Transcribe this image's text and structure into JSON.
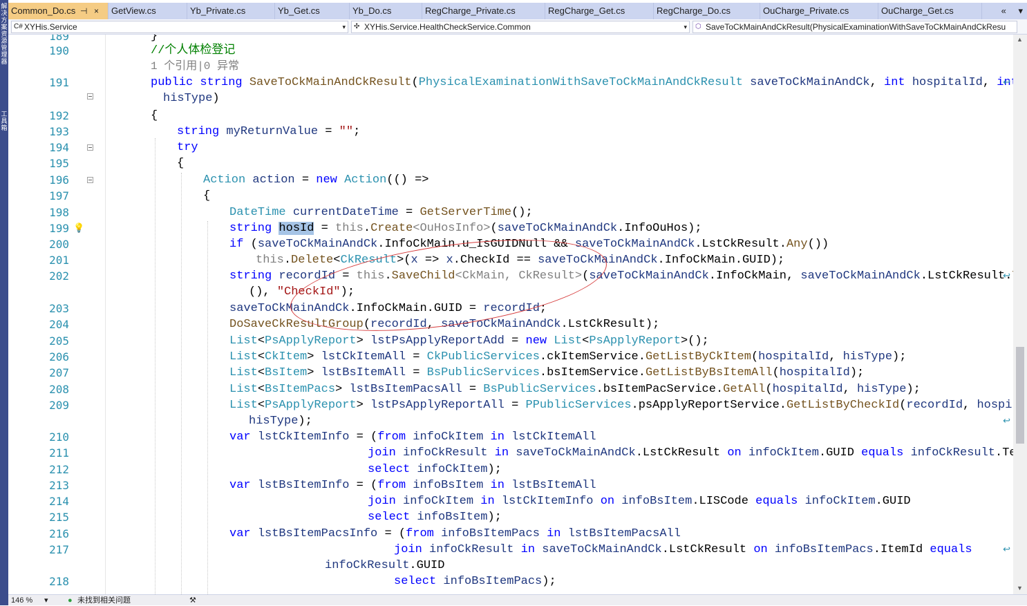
{
  "tabs": [
    {
      "label": "Common_Do.cs",
      "active": true
    },
    {
      "label": "GetView.cs"
    },
    {
      "label": "Yb_Private.cs"
    },
    {
      "label": "Yb_Get.cs"
    },
    {
      "label": "Yb_Do.cs"
    },
    {
      "label": "RegCharge_Private.cs"
    },
    {
      "label": "RegCharge_Get.cs"
    },
    {
      "label": "RegCharge_Do.cs"
    },
    {
      "label": "OuCharge_Private.cs"
    },
    {
      "label": "OuCharge_Get.cs"
    }
  ],
  "tab_pin": "⊣",
  "tab_close": "×",
  "tab_overflow": "«",
  "tab_dropdown": "▾",
  "side_labels": [
    "解决方案资源管理器",
    "工具箱"
  ],
  "nav": {
    "project_icon": "C#",
    "project": "XYHis.Service",
    "class": "XYHis.Service.HealthCheckService.Common",
    "member": "SaveToCkMainAndCkResult(PhysicalExaminationWithSaveToCkMainAndCkResu"
  },
  "status": {
    "zoom": "146 %",
    "issues": "未找到相关问题"
  },
  "codelens": "1 个引用|0 异常",
  "code_lines": [
    {
      "n": "189",
      "segs": [
        [
          "p",
          "}"
        ]
      ]
    },
    {
      "n": "190",
      "segs": [
        [
          "cm",
          "//个人体检登记"
        ]
      ]
    },
    {
      "n": "191",
      "segs": [
        [
          "k",
          "public"
        ],
        [
          "p",
          " "
        ],
        [
          "k",
          "string"
        ],
        [
          "p",
          " "
        ],
        [
          "m",
          "SaveToCkMainAndCkResult"
        ],
        [
          "p",
          "("
        ],
        [
          "t",
          "PhysicalExaminationWithSaveToCkMainAndCkResult"
        ],
        [
          "p",
          " "
        ],
        [
          "x",
          "saveToCkMainAndCk"
        ],
        [
          "p",
          ", "
        ],
        [
          "k",
          "int"
        ],
        [
          "p",
          " "
        ],
        [
          "x",
          "hospitalId"
        ],
        [
          "p",
          ", "
        ],
        [
          "k",
          "int"
        ]
      ]
    },
    {
      "n": "",
      "segs": [
        [
          "x",
          "hisType"
        ],
        [
          "p",
          ")"
        ]
      ]
    },
    {
      "n": "192",
      "segs": [
        [
          "p",
          "{"
        ]
      ]
    },
    {
      "n": "193",
      "segs": [
        [
          "k",
          "string"
        ],
        [
          "p",
          " "
        ],
        [
          "x",
          "myReturnValue"
        ],
        [
          "p",
          " = "
        ],
        [
          "s",
          "\"\""
        ],
        [
          "p",
          ";"
        ]
      ]
    },
    {
      "n": "194",
      "segs": [
        [
          "k",
          "try"
        ]
      ]
    },
    {
      "n": "195",
      "segs": [
        [
          "p",
          "{"
        ]
      ]
    },
    {
      "n": "196",
      "segs": [
        [
          "t",
          "Action"
        ],
        [
          "p",
          " "
        ],
        [
          "x",
          "action"
        ],
        [
          "p",
          " = "
        ],
        [
          "k",
          "new"
        ],
        [
          "p",
          " "
        ],
        [
          "t",
          "Action"
        ],
        [
          "p",
          "(() =>"
        ]
      ]
    },
    {
      "n": "197",
      "segs": [
        [
          "p",
          "{"
        ]
      ]
    },
    {
      "n": "198",
      "segs": [
        [
          "t",
          "DateTime"
        ],
        [
          "p",
          " "
        ],
        [
          "x",
          "currentDateTime"
        ],
        [
          "p",
          " = "
        ],
        [
          "m",
          "GetServerTime"
        ],
        [
          "p",
          "();"
        ]
      ]
    },
    {
      "n": "199",
      "segs": [
        [
          "k",
          "string"
        ],
        [
          "p",
          " "
        ],
        [
          "hl",
          "hosId"
        ],
        [
          "p",
          " = "
        ],
        [
          "g",
          "this"
        ],
        [
          "p",
          "."
        ],
        [
          "m",
          "Create"
        ],
        [
          "g",
          "<OuHosInfo>"
        ],
        [
          "p",
          "("
        ],
        [
          "x",
          "saveToCkMainAndCk"
        ],
        [
          "p",
          ".InfoOuHos);"
        ]
      ]
    },
    {
      "n": "200",
      "segs": [
        [
          "k",
          "if"
        ],
        [
          "p",
          " ("
        ],
        [
          "x",
          "saveToCkMainAndCk"
        ],
        [
          "p",
          ".InfoCkMain.u_IsGUIDNull && "
        ],
        [
          "x",
          "saveToCkMainAndCk"
        ],
        [
          "p",
          ".LstCkResult."
        ],
        [
          "m",
          "Any"
        ],
        [
          "p",
          "())"
        ]
      ]
    },
    {
      "n": "201",
      "segs": [
        [
          "g",
          "this"
        ],
        [
          "p",
          "."
        ],
        [
          "m",
          "Delete"
        ],
        [
          "p",
          "<"
        ],
        [
          "t",
          "CkResult"
        ],
        [
          "p",
          ">("
        ],
        [
          "x",
          "x"
        ],
        [
          "p",
          " => "
        ],
        [
          "x",
          "x"
        ],
        [
          "p",
          ".CheckId == "
        ],
        [
          "x",
          "saveToCkMainAndCk"
        ],
        [
          "p",
          ".InfoCkMain.GUID);"
        ]
      ]
    },
    {
      "n": "202",
      "segs": [
        [
          "k",
          "string"
        ],
        [
          "p",
          " "
        ],
        [
          "x",
          "recordId"
        ],
        [
          "p",
          " = "
        ],
        [
          "g",
          "this"
        ],
        [
          "p",
          "."
        ],
        [
          "m",
          "SaveChild"
        ],
        [
          "g",
          "<CkMain, CkResult>"
        ],
        [
          "p",
          "("
        ],
        [
          "x",
          "saveToCkMainAndCk"
        ],
        [
          "p",
          ".InfoCkMain, "
        ],
        [
          "x",
          "saveToCkMainAndCk"
        ],
        [
          "p",
          ".LstCkResult."
        ],
        [
          "m",
          "ToList"
        ]
      ]
    },
    {
      "n": "",
      "segs": [
        [
          "p",
          "(), "
        ],
        [
          "s",
          "\"CheckId\""
        ],
        [
          "p",
          ");"
        ]
      ]
    },
    {
      "n": "203",
      "segs": [
        [
          "x",
          "saveToCkMainAndCk"
        ],
        [
          "p",
          ".InfoCkMain.GUID = "
        ],
        [
          "x",
          "recordId"
        ],
        [
          "p",
          ";"
        ]
      ]
    },
    {
      "n": "204",
      "segs": [
        [
          "m",
          "DoSaveCkResultGroup"
        ],
        [
          "p",
          "("
        ],
        [
          "x",
          "recordId"
        ],
        [
          "p",
          ", "
        ],
        [
          "x",
          "saveToCkMainAndCk"
        ],
        [
          "p",
          ".LstCkResult);"
        ]
      ]
    },
    {
      "n": "205",
      "segs": [
        [
          "t",
          "List"
        ],
        [
          "p",
          "<"
        ],
        [
          "t",
          "PsApplyReport"
        ],
        [
          "p",
          "> "
        ],
        [
          "x",
          "lstPsApplyReportAdd"
        ],
        [
          "p",
          " = "
        ],
        [
          "k",
          "new"
        ],
        [
          "p",
          " "
        ],
        [
          "t",
          "List"
        ],
        [
          "p",
          "<"
        ],
        [
          "t",
          "PsApplyReport"
        ],
        [
          "p",
          ">();"
        ]
      ]
    },
    {
      "n": "206",
      "segs": [
        [
          "t",
          "List"
        ],
        [
          "p",
          "<"
        ],
        [
          "t",
          "CkItem"
        ],
        [
          "p",
          "> "
        ],
        [
          "x",
          "lstCkItemAll"
        ],
        [
          "p",
          " = "
        ],
        [
          "t",
          "CkPublicServices"
        ],
        [
          "p",
          ".ckItemService."
        ],
        [
          "m",
          "GetListByCkItem"
        ],
        [
          "p",
          "("
        ],
        [
          "x",
          "hospitalId"
        ],
        [
          "p",
          ", "
        ],
        [
          "x",
          "hisType"
        ],
        [
          "p",
          ");"
        ]
      ]
    },
    {
      "n": "207",
      "segs": [
        [
          "t",
          "List"
        ],
        [
          "p",
          "<"
        ],
        [
          "t",
          "BsItem"
        ],
        [
          "p",
          "> "
        ],
        [
          "x",
          "lstBsItemAll"
        ],
        [
          "p",
          " = "
        ],
        [
          "t",
          "BsPublicServices"
        ],
        [
          "p",
          ".bsItemService."
        ],
        [
          "m",
          "GetListByBsItemAll"
        ],
        [
          "p",
          "("
        ],
        [
          "x",
          "hospitalId"
        ],
        [
          "p",
          ");"
        ]
      ]
    },
    {
      "n": "208",
      "segs": [
        [
          "t",
          "List"
        ],
        [
          "p",
          "<"
        ],
        [
          "t",
          "BsItemPacs"
        ],
        [
          "p",
          "> "
        ],
        [
          "x",
          "lstBsItemPacsAll"
        ],
        [
          "p",
          " = "
        ],
        [
          "t",
          "BsPublicServices"
        ],
        [
          "p",
          ".bsItemPacService."
        ],
        [
          "m",
          "GetAll"
        ],
        [
          "p",
          "("
        ],
        [
          "x",
          "hospitalId"
        ],
        [
          "p",
          ", "
        ],
        [
          "x",
          "hisType"
        ],
        [
          "p",
          ");"
        ]
      ]
    },
    {
      "n": "209",
      "segs": [
        [
          "t",
          "List"
        ],
        [
          "p",
          "<"
        ],
        [
          "t",
          "PsApplyReport"
        ],
        [
          "p",
          "> "
        ],
        [
          "x",
          "lstPsApplyReportAll"
        ],
        [
          "p",
          " = "
        ],
        [
          "t",
          "PPublicServices"
        ],
        [
          "p",
          ".psApplyReportService."
        ],
        [
          "m",
          "GetListByCheckId"
        ],
        [
          "p",
          "("
        ],
        [
          "x",
          "recordId"
        ],
        [
          "p",
          ", "
        ],
        [
          "x",
          "hospitalId"
        ],
        [
          "p",
          ","
        ]
      ]
    },
    {
      "n": "",
      "segs": [
        [
          "x",
          "hisType"
        ],
        [
          "p",
          ");"
        ]
      ]
    },
    {
      "n": "210",
      "segs": [
        [
          "k",
          "var"
        ],
        [
          "p",
          " "
        ],
        [
          "x",
          "lstCkItemInfo"
        ],
        [
          "p",
          " = ("
        ],
        [
          "k",
          "from"
        ],
        [
          "p",
          " "
        ],
        [
          "x",
          "infoCkItem"
        ],
        [
          "p",
          " "
        ],
        [
          "k",
          "in"
        ],
        [
          "p",
          " "
        ],
        [
          "x",
          "lstCkItemAll"
        ]
      ]
    },
    {
      "n": "211",
      "segs": [
        [
          "k",
          "join"
        ],
        [
          "p",
          " "
        ],
        [
          "x",
          "infoCkResult"
        ],
        [
          "p",
          " "
        ],
        [
          "k",
          "in"
        ],
        [
          "p",
          " "
        ],
        [
          "x",
          "saveToCkMainAndCk"
        ],
        [
          "p",
          ".LstCkResult "
        ],
        [
          "k",
          "on"
        ],
        [
          "p",
          " "
        ],
        [
          "x",
          "infoCkItem"
        ],
        [
          "p",
          ".GUID "
        ],
        [
          "k",
          "equals"
        ],
        [
          "p",
          " "
        ],
        [
          "x",
          "infoCkResult"
        ],
        [
          "p",
          ".TestId"
        ]
      ]
    },
    {
      "n": "212",
      "segs": [
        [
          "k",
          "select"
        ],
        [
          "p",
          " "
        ],
        [
          "x",
          "infoCkItem"
        ],
        [
          "p",
          ");"
        ]
      ]
    },
    {
      "n": "213",
      "segs": [
        [
          "k",
          "var"
        ],
        [
          "p",
          " "
        ],
        [
          "x",
          "lstBsItemInfo"
        ],
        [
          "p",
          " = ("
        ],
        [
          "k",
          "from"
        ],
        [
          "p",
          " "
        ],
        [
          "x",
          "infoBsItem"
        ],
        [
          "p",
          " "
        ],
        [
          "k",
          "in"
        ],
        [
          "p",
          " "
        ],
        [
          "x",
          "lstBsItemAll"
        ]
      ]
    },
    {
      "n": "214",
      "segs": [
        [
          "k",
          "join"
        ],
        [
          "p",
          " "
        ],
        [
          "x",
          "infoCkItem"
        ],
        [
          "p",
          " "
        ],
        [
          "k",
          "in"
        ],
        [
          "p",
          " "
        ],
        [
          "x",
          "lstCkItemInfo"
        ],
        [
          "p",
          " "
        ],
        [
          "k",
          "on"
        ],
        [
          "p",
          " "
        ],
        [
          "x",
          "infoBsItem"
        ],
        [
          "p",
          ".LISCode "
        ],
        [
          "k",
          "equals"
        ],
        [
          "p",
          " "
        ],
        [
          "x",
          "infoCkItem"
        ],
        [
          "p",
          ".GUID"
        ]
      ]
    },
    {
      "n": "215",
      "segs": [
        [
          "k",
          "select"
        ],
        [
          "p",
          " "
        ],
        [
          "x",
          "infoBsItem"
        ],
        [
          "p",
          ");"
        ]
      ]
    },
    {
      "n": "216",
      "segs": [
        [
          "k",
          "var"
        ],
        [
          "p",
          " "
        ],
        [
          "x",
          "lstBsItemPacsInfo"
        ],
        [
          "p",
          " = ("
        ],
        [
          "k",
          "from"
        ],
        [
          "p",
          " "
        ],
        [
          "x",
          "infoBsItemPacs"
        ],
        [
          "p",
          " "
        ],
        [
          "k",
          "in"
        ],
        [
          "p",
          " "
        ],
        [
          "x",
          "lstBsItemPacsAll"
        ]
      ]
    },
    {
      "n": "217",
      "segs": [
        [
          "k",
          "join"
        ],
        [
          "p",
          " "
        ],
        [
          "x",
          "infoCkResult"
        ],
        [
          "p",
          " "
        ],
        [
          "k",
          "in"
        ],
        [
          "p",
          " "
        ],
        [
          "x",
          "saveToCkMainAndCk"
        ],
        [
          "p",
          ".LstCkResult "
        ],
        [
          "k",
          "on"
        ],
        [
          "p",
          " "
        ],
        [
          "x",
          "infoBsItemPacs"
        ],
        [
          "p",
          ".ItemId "
        ],
        [
          "k",
          "equals"
        ]
      ]
    },
    {
      "n": "",
      "segs": [
        [
          "x",
          "infoCkResult"
        ],
        [
          "p",
          ".GUID"
        ]
      ]
    },
    {
      "n": "218",
      "segs": [
        [
          "k",
          "select"
        ],
        [
          "p",
          " "
        ],
        [
          "x",
          "infoBsItemPacs"
        ],
        [
          "p",
          ");"
        ]
      ]
    }
  ]
}
